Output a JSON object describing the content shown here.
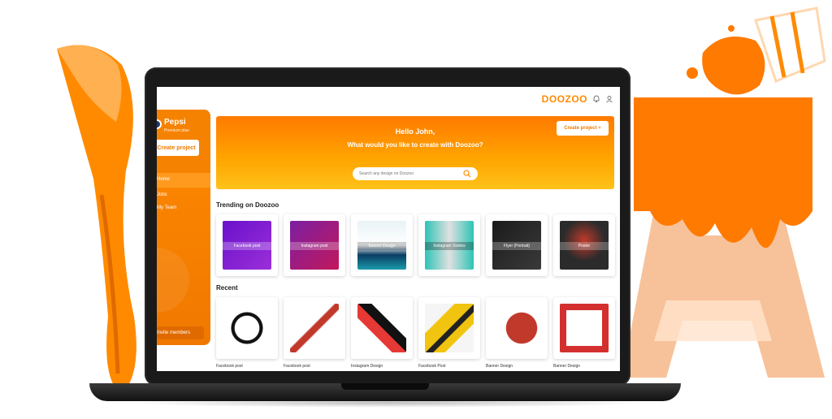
{
  "brand": "DOOZOO",
  "sidebar": {
    "user_name": "Pepsi",
    "plan": "Premium plan",
    "create_button": "Create project",
    "nav": [
      "Home",
      "Jobs",
      "My Team"
    ],
    "invite": "Invite members"
  },
  "hero": {
    "greeting": "Hello John,",
    "question": "What would you like to create with Doozoo?",
    "search_placeholder": "Search any design on Doozoo",
    "create_button": "Create project +"
  },
  "trending": {
    "title": "Trending on Doozoo",
    "items": [
      {
        "label": "Facebook post"
      },
      {
        "label": "Instagram post"
      },
      {
        "label": "Banner Design"
      },
      {
        "label": "Instagram Stories"
      },
      {
        "label": "Flyer (Portrait)"
      },
      {
        "label": "Poster"
      }
    ]
  },
  "recent": {
    "title": "Recent",
    "items": [
      {
        "caption": "Facebook post"
      },
      {
        "caption": "Facebook post"
      },
      {
        "caption": "Instagram Design"
      },
      {
        "caption": "Facebook Post"
      },
      {
        "caption": "Banner Design"
      },
      {
        "caption": "Banner Design"
      }
    ]
  },
  "colors": {
    "accent": "#ff8a00",
    "accent_dark": "#f07800",
    "hero_top": "#ff7a00",
    "hero_bottom": "#ffc21a"
  },
  "icons": [
    "bell-icon",
    "user-icon",
    "search-icon"
  ]
}
